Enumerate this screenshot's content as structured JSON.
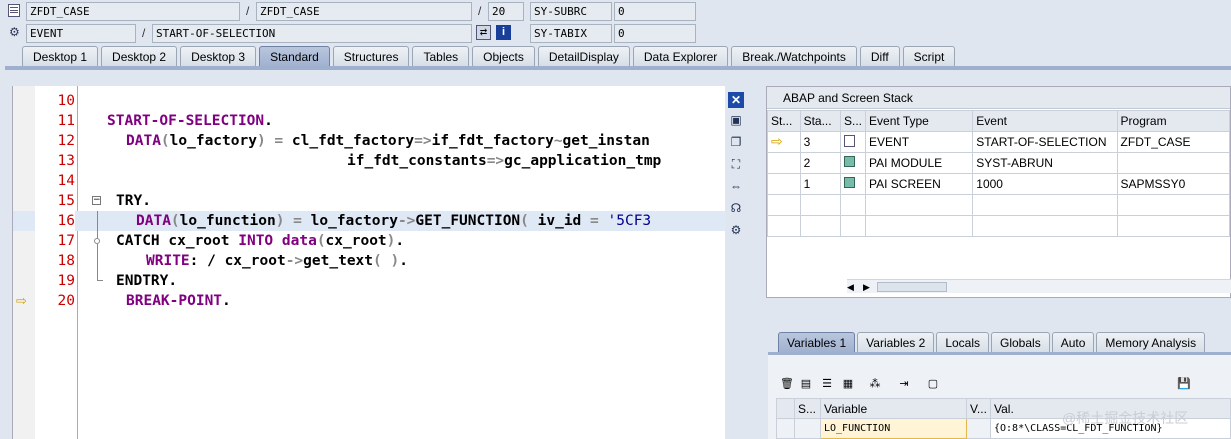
{
  "header": {
    "row1": {
      "program": "ZFDT_CASE",
      "include": "ZFDT_CASE",
      "line": "20",
      "sysfield": "SY-SUBRC",
      "sysvalue": "0"
    },
    "row2": {
      "type": "EVENT",
      "name": "START-OF-SELECTION",
      "sysfield": "SY-TABIX",
      "sysvalue": "0"
    },
    "separator": "/"
  },
  "tabs": [
    "Desktop 1",
    "Desktop 2",
    "Desktop 3",
    "Standard",
    "Structures",
    "Tables",
    "Objects",
    "DetailDisplay",
    "Data Explorer",
    "Break./Watchpoints",
    "Diff",
    "Script"
  ],
  "active_tab": "Standard",
  "code": {
    "line_numbers": [
      "10",
      "11",
      "12",
      "13",
      "14",
      "15",
      "16",
      "17",
      "18",
      "19",
      "20"
    ],
    "l11": {
      "kw": "START-OF-SELECTION",
      "end": "."
    },
    "l12": {
      "kw": "DATA",
      "p1": "(",
      "a1": "lo_factory",
      "p2": ")",
      "eq": " = ",
      "a2": "cl_fdt_factory",
      "arrow": "=>",
      "a3": "if_fdt_factory",
      "tilde": "~",
      "a4": "get_instan"
    },
    "l13": {
      "a1": "if_fdt_constants",
      "arrow": "=>",
      "a2": "gc_application_tmp"
    },
    "l15": {
      "kw": "TRY",
      "end": "."
    },
    "l16": {
      "kw": "DATA",
      "p1": "(",
      "a1": "lo_function",
      "p2": ")",
      "eq": " = ",
      "a2": "lo_factory",
      "arrow": "->",
      "a3": "GET_FUNCTION",
      "p3": "( ",
      "a4": "iv_id",
      "eq2": " = ",
      "str": "'5CF3"
    },
    "l17": {
      "kw": "CATCH",
      "a1": " cx_root ",
      "kw2": "INTO",
      "kw3": " data",
      "p1": "(",
      "a2": "cx_root",
      "p2": ")",
      "end": "."
    },
    "l18": {
      "kw": "WRITE",
      "colon": ":",
      "a1": " / cx_root",
      "arrow": "->",
      "a2": "get_text",
      "p1": "( )",
      "end": "."
    },
    "l19": {
      "kw": "ENDTRY",
      "end": "."
    },
    "l20": {
      "kw": "BREAK-POINT",
      "end": "."
    }
  },
  "stack": {
    "title": "ABAP and Screen Stack",
    "columns": [
      "St...",
      "Sta...",
      "S...",
      "Event Type",
      "Event",
      "Program"
    ],
    "rows": [
      {
        "level": "3",
        "type": "EVENT",
        "event": "START-OF-SELECTION",
        "program": "ZFDT_CASE"
      },
      {
        "level": "2",
        "type": "PAI MODULE",
        "event": "SYST-ABRUN",
        "program": ""
      },
      {
        "level": "1",
        "type": "PAI SCREEN",
        "event": "1000",
        "program": "SAPMSSY0"
      }
    ]
  },
  "var_tabs": [
    "Variables 1",
    "Variables 2",
    "Locals",
    "Globals",
    "Auto",
    "Memory Analysis"
  ],
  "active_var_tab": "Variables 1",
  "variables": {
    "columns": [
      "S...",
      "Variable",
      "V...",
      "Val."
    ],
    "rows": [
      {
        "name": "LO_FUNCTION",
        "value": "{O:8*\\CLASS=CL_FDT_FUNCTION}"
      }
    ]
  },
  "watermark": "@稀土掘金技术社区"
}
